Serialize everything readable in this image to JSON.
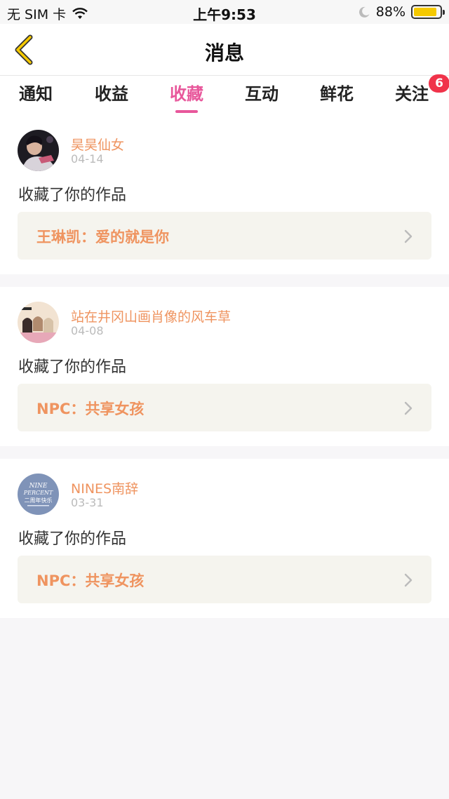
{
  "status_bar": {
    "carrier": "无 SIM 卡",
    "time": "上午9:53",
    "battery_percent": "88%",
    "battery_level": 0.88,
    "battery_color": "#f5c900"
  },
  "navbar": {
    "title": "消息",
    "back_icon": "chevron-left-icon",
    "back_color": "#f5c900"
  },
  "tabs": [
    {
      "label": "通知",
      "active": false
    },
    {
      "label": "收益",
      "active": false
    },
    {
      "label": "收藏",
      "active": true
    },
    {
      "label": "互动",
      "active": false
    },
    {
      "label": "鲜花",
      "active": false
    },
    {
      "label": "关注",
      "active": false,
      "badge": "6"
    }
  ],
  "accent_color": "#e8579b",
  "items": [
    {
      "username": "昊昊仙女",
      "date": "04-14",
      "action": "收藏了你的作品",
      "work_title": "王琳凯：爱的就是你"
    },
    {
      "username": "站在井冈山画肖像的风车草",
      "date": "04-08",
      "action": "收藏了你的作品",
      "work_title": "NPC：共享女孩"
    },
    {
      "username": "NINES南辞",
      "date": "03-31",
      "action": "收藏了你的作品",
      "work_title": "NPC：共享女孩",
      "avatar_text_1": "NINE",
      "avatar_text_2": "PERCENT",
      "avatar_text_3": "二周年快乐"
    }
  ]
}
